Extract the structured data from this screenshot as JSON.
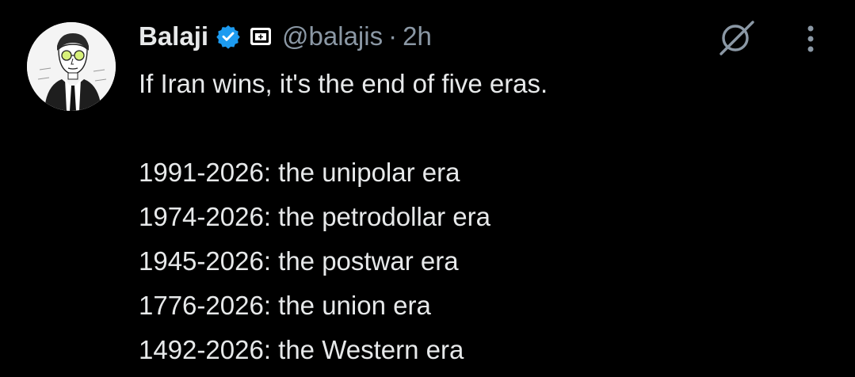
{
  "tweet": {
    "author_name": "Balaji",
    "handle": "@balajis",
    "separator": "·",
    "time": "2h",
    "verified_badge": "verified-check-icon",
    "affiliation_badge": "affiliate-square-plus-icon",
    "colors": {
      "background": "#000000",
      "text": "#e7e9ea",
      "secondary": "#8b98a5",
      "verified": "#1d9bf0"
    },
    "text": {
      "intro": "If Iran wins, it's the end of five eras.",
      "lines": [
        "1991-2026: the unipolar era",
        "1974-2026: the petrodollar era",
        "1945-2026: the postwar era",
        "1776-2026: the union era",
        "1492-2026: the Western era"
      ]
    },
    "actions": {
      "grok_icon": "grok-slash-icon",
      "more_icon": "more-vertical-icon"
    }
  }
}
